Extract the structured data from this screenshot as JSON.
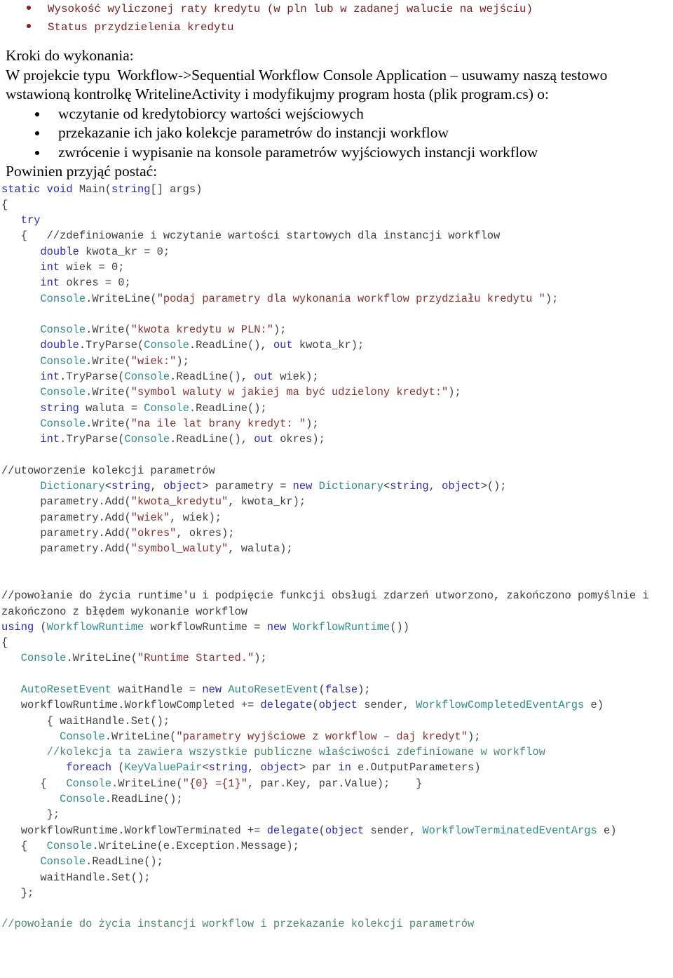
{
  "document": {
    "language": "pl",
    "colors": {
      "keyword": "#2a2ab0",
      "type": "#2e8b8b",
      "string": "#8a3030",
      "comment_dark": "#3b3b3b",
      "comment_green": "#4a8a6a",
      "plain": "#404040",
      "mono_bullet_red": "#7a1c1c",
      "background": "#ffffff"
    }
  },
  "top_requirements": {
    "bullets": [
      "Wysokość wyliczonej raty kredytu (w pln lub w zadanej walucie na wejściu)",
      "Status przydzielenia kredytu"
    ]
  },
  "steps_section": {
    "heading": "Kroki do wykonania:",
    "intro_line_1": "W projekcie typu  Workflow->Sequential Workflow Console Application – usuwamy naszą testowo",
    "intro_line_2": "wstawioną kontrolkę WritelineActivity i modyfikujmy program hosta (plik program.cs) o:",
    "bullets": [
      "wczytanie od kredytobiorcy wartości wejściowych",
      "przekazanie ich jako kolekcje parametrów do instancji workflow",
      "zwrócenie i wypisanie na konsole parametrów wyjściowych instancji workflow"
    ],
    "should_have_form": "Powinien przyjąć postać:"
  },
  "code": {
    "lines": [
      {
        "id": "l01",
        "tokens": [
          {
            "t": "static ",
            "c": "kw"
          },
          {
            "t": "void ",
            "c": "kw"
          },
          {
            "t": "Main(",
            "c": "pln"
          },
          {
            "t": "string",
            "c": "kw"
          },
          {
            "t": "[] args)",
            "c": "pln"
          }
        ]
      },
      {
        "id": "l02",
        "tokens": [
          {
            "t": "{",
            "c": "pln"
          }
        ]
      },
      {
        "id": "l03",
        "tokens": [
          {
            "t": "   ",
            "c": "pln"
          },
          {
            "t": "try",
            "c": "kw"
          }
        ]
      },
      {
        "id": "l04",
        "tokens": [
          {
            "t": "   {   ",
            "c": "pln"
          },
          {
            "t": "//zdefiniowanie i wczytanie wartości startowych dla instancji workflow",
            "c": "cmt"
          }
        ]
      },
      {
        "id": "l05",
        "tokens": [
          {
            "t": "      ",
            "c": "pln"
          },
          {
            "t": "double",
            "c": "kw"
          },
          {
            "t": " kwota_kr = 0;",
            "c": "pln"
          }
        ]
      },
      {
        "id": "l06",
        "tokens": [
          {
            "t": "      ",
            "c": "pln"
          },
          {
            "t": "int",
            "c": "kw"
          },
          {
            "t": " wiek = 0;",
            "c": "pln"
          }
        ]
      },
      {
        "id": "l07",
        "tokens": [
          {
            "t": "      ",
            "c": "pln"
          },
          {
            "t": "int",
            "c": "kw"
          },
          {
            "t": " okres = 0;",
            "c": "pln"
          }
        ]
      },
      {
        "id": "l08",
        "tokens": [
          {
            "t": "      ",
            "c": "pln"
          },
          {
            "t": "Console",
            "c": "type"
          },
          {
            "t": ".WriteLine(",
            "c": "pln"
          },
          {
            "t": "\"podaj parametry dla wykonania workflow przydziału kredytu \"",
            "c": "str"
          },
          {
            "t": ");",
            "c": "pln"
          }
        ]
      },
      {
        "id": "l09",
        "tokens": [
          {
            "t": "",
            "c": "pln"
          }
        ]
      },
      {
        "id": "l10",
        "tokens": [
          {
            "t": "      ",
            "c": "pln"
          },
          {
            "t": "Console",
            "c": "type"
          },
          {
            "t": ".Write(",
            "c": "pln"
          },
          {
            "t": "\"kwota kredytu w PLN:\"",
            "c": "str"
          },
          {
            "t": ");",
            "c": "pln"
          }
        ]
      },
      {
        "id": "l11",
        "tokens": [
          {
            "t": "      ",
            "c": "pln"
          },
          {
            "t": "double",
            "c": "kw"
          },
          {
            "t": ".TryParse(",
            "c": "pln"
          },
          {
            "t": "Console",
            "c": "type"
          },
          {
            "t": ".ReadLine(), ",
            "c": "pln"
          },
          {
            "t": "out",
            "c": "kw"
          },
          {
            "t": " kwota_kr);",
            "c": "pln"
          }
        ]
      },
      {
        "id": "l12",
        "tokens": [
          {
            "t": "      ",
            "c": "pln"
          },
          {
            "t": "Console",
            "c": "type"
          },
          {
            "t": ".Write(",
            "c": "pln"
          },
          {
            "t": "\"wiek:\"",
            "c": "str"
          },
          {
            "t": ");",
            "c": "pln"
          }
        ]
      },
      {
        "id": "l13",
        "tokens": [
          {
            "t": "      ",
            "c": "pln"
          },
          {
            "t": "int",
            "c": "kw"
          },
          {
            "t": ".TryParse(",
            "c": "pln"
          },
          {
            "t": "Console",
            "c": "type"
          },
          {
            "t": ".ReadLine(), ",
            "c": "pln"
          },
          {
            "t": "out",
            "c": "kw"
          },
          {
            "t": " wiek);",
            "c": "pln"
          }
        ]
      },
      {
        "id": "l14",
        "tokens": [
          {
            "t": "      ",
            "c": "pln"
          },
          {
            "t": "Console",
            "c": "type"
          },
          {
            "t": ".Write(",
            "c": "pln"
          },
          {
            "t": "\"symbol waluty w jakiej ma być udzielony kredyt:\"",
            "c": "str"
          },
          {
            "t": ");",
            "c": "pln"
          }
        ]
      },
      {
        "id": "l15",
        "tokens": [
          {
            "t": "      ",
            "c": "pln"
          },
          {
            "t": "string",
            "c": "kw"
          },
          {
            "t": " waluta = ",
            "c": "pln"
          },
          {
            "t": "Console",
            "c": "type"
          },
          {
            "t": ".ReadLine();",
            "c": "pln"
          }
        ]
      },
      {
        "id": "l16",
        "tokens": [
          {
            "t": "      ",
            "c": "pln"
          },
          {
            "t": "Console",
            "c": "type"
          },
          {
            "t": ".Write(",
            "c": "pln"
          },
          {
            "t": "\"na ile lat brany kredyt: \"",
            "c": "str"
          },
          {
            "t": ");",
            "c": "pln"
          }
        ]
      },
      {
        "id": "l17",
        "tokens": [
          {
            "t": "      ",
            "c": "pln"
          },
          {
            "t": "int",
            "c": "kw"
          },
          {
            "t": ".TryParse(",
            "c": "pln"
          },
          {
            "t": "Console",
            "c": "type"
          },
          {
            "t": ".ReadLine(), ",
            "c": "pln"
          },
          {
            "t": "out",
            "c": "kw"
          },
          {
            "t": " okres);",
            "c": "pln"
          }
        ]
      },
      {
        "id": "l18",
        "tokens": [
          {
            "t": "",
            "c": "pln"
          }
        ]
      },
      {
        "id": "l19",
        "tokens": [
          {
            "t": "//utoworzenie kolekcji parametrów",
            "c": "cmt"
          }
        ]
      },
      {
        "id": "l20",
        "tokens": [
          {
            "t": "      ",
            "c": "pln"
          },
          {
            "t": "Dictionary",
            "c": "type"
          },
          {
            "t": "<",
            "c": "pln"
          },
          {
            "t": "string",
            "c": "kw"
          },
          {
            "t": ", ",
            "c": "pln"
          },
          {
            "t": "object",
            "c": "kw"
          },
          {
            "t": "> parametry = ",
            "c": "pln"
          },
          {
            "t": "new",
            "c": "kw"
          },
          {
            "t": " ",
            "c": "pln"
          },
          {
            "t": "Dictionary",
            "c": "type"
          },
          {
            "t": "<",
            "c": "pln"
          },
          {
            "t": "string",
            "c": "kw"
          },
          {
            "t": ", ",
            "c": "pln"
          },
          {
            "t": "object",
            "c": "kw"
          },
          {
            "t": ">();",
            "c": "pln"
          }
        ]
      },
      {
        "id": "l21",
        "tokens": [
          {
            "t": "      parametry.Add(",
            "c": "pln"
          },
          {
            "t": "\"kwota_kredytu\"",
            "c": "str"
          },
          {
            "t": ", kwota_kr);",
            "c": "pln"
          }
        ]
      },
      {
        "id": "l22",
        "tokens": [
          {
            "t": "      parametry.Add(",
            "c": "pln"
          },
          {
            "t": "\"wiek\"",
            "c": "str"
          },
          {
            "t": ", wiek);",
            "c": "pln"
          }
        ]
      },
      {
        "id": "l23",
        "tokens": [
          {
            "t": "      parametry.Add(",
            "c": "pln"
          },
          {
            "t": "\"okres\"",
            "c": "str"
          },
          {
            "t": ", okres);",
            "c": "pln"
          }
        ]
      },
      {
        "id": "l24",
        "tokens": [
          {
            "t": "      parametry.Add(",
            "c": "pln"
          },
          {
            "t": "\"symbol_waluty\"",
            "c": "str"
          },
          {
            "t": ", waluta);",
            "c": "pln"
          }
        ]
      },
      {
        "id": "l25",
        "tokens": [
          {
            "t": "",
            "c": "pln"
          }
        ]
      },
      {
        "id": "l26",
        "tokens": [
          {
            "t": "",
            "c": "pln"
          }
        ]
      },
      {
        "id": "l27",
        "tokens": [
          {
            "t": "//powołanie do życia runtime'u i podpięcie funkcji obsługi zdarzeń utworzono, zakończono pomyślnie i zakończono z błędem wykonanie workflow",
            "c": "cmt"
          }
        ]
      },
      {
        "id": "l28",
        "tokens": [
          {
            "t": "using",
            "c": "kw"
          },
          {
            "t": " (",
            "c": "pln"
          },
          {
            "t": "WorkflowRuntime",
            "c": "type"
          },
          {
            "t": " workflowRuntime = ",
            "c": "pln"
          },
          {
            "t": "new",
            "c": "kw"
          },
          {
            "t": " ",
            "c": "pln"
          },
          {
            "t": "WorkflowRuntime",
            "c": "type"
          },
          {
            "t": "())",
            "c": "pln"
          }
        ]
      },
      {
        "id": "l29",
        "tokens": [
          {
            "t": "{",
            "c": "pln"
          }
        ]
      },
      {
        "id": "l30",
        "tokens": [
          {
            "t": "   ",
            "c": "pln"
          },
          {
            "t": "Console",
            "c": "type"
          },
          {
            "t": ".WriteLine(",
            "c": "pln"
          },
          {
            "t": "\"Runtime Started.\"",
            "c": "str"
          },
          {
            "t": ");",
            "c": "pln"
          }
        ]
      },
      {
        "id": "l31",
        "tokens": [
          {
            "t": "",
            "c": "pln"
          }
        ]
      },
      {
        "id": "l32",
        "tokens": [
          {
            "t": "   ",
            "c": "pln"
          },
          {
            "t": "AutoResetEvent",
            "c": "type"
          },
          {
            "t": " waitHandle = ",
            "c": "pln"
          },
          {
            "t": "new",
            "c": "kw"
          },
          {
            "t": " ",
            "c": "pln"
          },
          {
            "t": "AutoResetEvent",
            "c": "type"
          },
          {
            "t": "(",
            "c": "pln"
          },
          {
            "t": "false",
            "c": "kw"
          },
          {
            "t": ");",
            "c": "pln"
          }
        ]
      },
      {
        "id": "l33",
        "tokens": [
          {
            "t": "   workflowRuntime.WorkflowCompleted += ",
            "c": "pln"
          },
          {
            "t": "delegate",
            "c": "kw"
          },
          {
            "t": "(",
            "c": "pln"
          },
          {
            "t": "object",
            "c": "kw"
          },
          {
            "t": " sender, ",
            "c": "pln"
          },
          {
            "t": "WorkflowCompletedEventArgs",
            "c": "type"
          },
          {
            "t": " e)",
            "c": "pln"
          }
        ]
      },
      {
        "id": "l34",
        "tokens": [
          {
            "t": "       { waitHandle.Set();",
            "c": "pln"
          }
        ]
      },
      {
        "id": "l35",
        "tokens": [
          {
            "t": "         ",
            "c": "pln"
          },
          {
            "t": "Console",
            "c": "type"
          },
          {
            "t": ".WriteLine(",
            "c": "pln"
          },
          {
            "t": "\"parametry wyjściowe z workflow – daj kredyt\"",
            "c": "str"
          },
          {
            "t": ");",
            "c": "pln"
          }
        ]
      },
      {
        "id": "l36",
        "tokens": [
          {
            "t": "       ",
            "c": "pln"
          },
          {
            "t": "//kolekcja ta zawiera wszystkie publiczne właściwości zdefiniowane w workflow",
            "c": "cmtg"
          }
        ]
      },
      {
        "id": "l37",
        "tokens": [
          {
            "t": "          ",
            "c": "pln"
          },
          {
            "t": "foreach",
            "c": "kw"
          },
          {
            "t": " (",
            "c": "pln"
          },
          {
            "t": "KeyValuePair",
            "c": "type"
          },
          {
            "t": "<",
            "c": "pln"
          },
          {
            "t": "string",
            "c": "kw"
          },
          {
            "t": ", ",
            "c": "pln"
          },
          {
            "t": "object",
            "c": "kw"
          },
          {
            "t": "> par ",
            "c": "pln"
          },
          {
            "t": "in",
            "c": "kw"
          },
          {
            "t": " e.OutputParameters)",
            "c": "pln"
          }
        ]
      },
      {
        "id": "l38",
        "tokens": [
          {
            "t": "      {   ",
            "c": "pln"
          },
          {
            "t": "Console",
            "c": "type"
          },
          {
            "t": ".WriteLine(",
            "c": "pln"
          },
          {
            "t": "\"{0} ={1}\"",
            "c": "str"
          },
          {
            "t": ", par.Key, par.Value);    }",
            "c": "pln"
          }
        ]
      },
      {
        "id": "l39",
        "tokens": [
          {
            "t": "         ",
            "c": "pln"
          },
          {
            "t": "Console",
            "c": "type"
          },
          {
            "t": ".ReadLine();",
            "c": "pln"
          }
        ]
      },
      {
        "id": "l40",
        "tokens": [
          {
            "t": "       };",
            "c": "pln"
          }
        ]
      },
      {
        "id": "l41",
        "tokens": [
          {
            "t": "   workflowRuntime.WorkflowTerminated += ",
            "c": "pln"
          },
          {
            "t": "delegate",
            "c": "kw"
          },
          {
            "t": "(",
            "c": "pln"
          },
          {
            "t": "object",
            "c": "kw"
          },
          {
            "t": " sender, ",
            "c": "pln"
          },
          {
            "t": "WorkflowTerminatedEventArgs",
            "c": "type"
          },
          {
            "t": " e)",
            "c": "pln"
          }
        ]
      },
      {
        "id": "l42",
        "tokens": [
          {
            "t": "   {   ",
            "c": "pln"
          },
          {
            "t": "Console",
            "c": "type"
          },
          {
            "t": ".WriteLine(e.Exception.Message);",
            "c": "pln"
          }
        ]
      },
      {
        "id": "l43",
        "tokens": [
          {
            "t": "      ",
            "c": "pln"
          },
          {
            "t": "Console",
            "c": "type"
          },
          {
            "t": ".ReadLine();",
            "c": "pln"
          }
        ]
      },
      {
        "id": "l44",
        "tokens": [
          {
            "t": "      waitHandle.Set();",
            "c": "pln"
          }
        ]
      },
      {
        "id": "l45",
        "tokens": [
          {
            "t": "   };",
            "c": "pln"
          }
        ]
      },
      {
        "id": "l46",
        "tokens": [
          {
            "t": "",
            "c": "pln"
          }
        ]
      },
      {
        "id": "l47",
        "tokens": [
          {
            "t": "//powołanie do życia instancji workflow i przekazanie kolekcji parametrów",
            "c": "cmtg"
          }
        ]
      }
    ]
  }
}
